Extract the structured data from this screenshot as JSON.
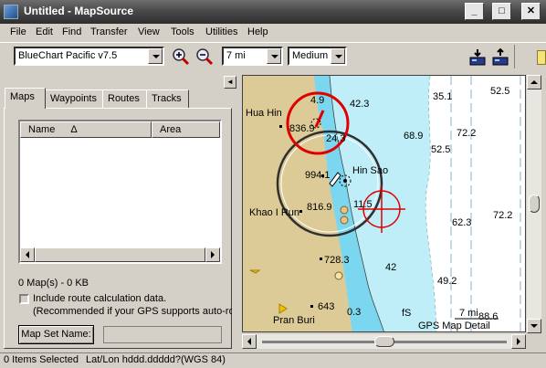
{
  "window": {
    "title": "Untitled - MapSource",
    "minimize_glyph": "_",
    "maximize_glyph": "□",
    "close_glyph": "✕"
  },
  "menu": [
    "File",
    "Edit",
    "Find",
    "Transfer",
    "View",
    "Tools",
    "Utilities",
    "Help"
  ],
  "toolbar": {
    "product": "BlueChart Pacific v7.5",
    "zoom_scale": "7 mi",
    "detail": "Medium"
  },
  "left": {
    "tabs": [
      "Maps",
      "Waypoints",
      "Routes",
      "Tracks"
    ],
    "active_tab": "Maps",
    "columns": [
      "Name",
      "Area"
    ],
    "sort_indicator": "Δ",
    "map_count": "0 Map(s) - 0 KB",
    "checkbox_label": "Include route calculation data.",
    "checkbox_note": "(Recommended if your GPS supports auto-rou",
    "map_set_button": "Map Set Name:",
    "collapse_glyph": "◄"
  },
  "map": {
    "labels": {
      "hua_hin": "Hua Hin",
      "hin_sao": "Hin Sao",
      "khao_i_run": "Khao I Run",
      "pran_buri": "Pran Buri",
      "detail_caption": "GPS Map Detail",
      "scale_label": "7 mi",
      "fs_label": "fS"
    },
    "soundings": [
      "4.9",
      "42.3",
      "35.1",
      "52.5",
      "836.9",
      "24.3",
      "68.9",
      "72.2",
      "52.5",
      "994.1",
      "11.5",
      "816.9",
      "62.3",
      "72.2",
      "728.3",
      "42",
      "49.2",
      "643",
      "0.3",
      "88.6"
    ],
    "colors": {
      "land": "#dccb97",
      "shallow": "#7ad7ef",
      "mid": "#bfeef8",
      "deep": "#ffffff",
      "accent": "#e00000"
    }
  },
  "status": {
    "selected": "0 Items Selected",
    "coords": "Lat/Lon hddd.ddddd?(WGS 84)"
  }
}
